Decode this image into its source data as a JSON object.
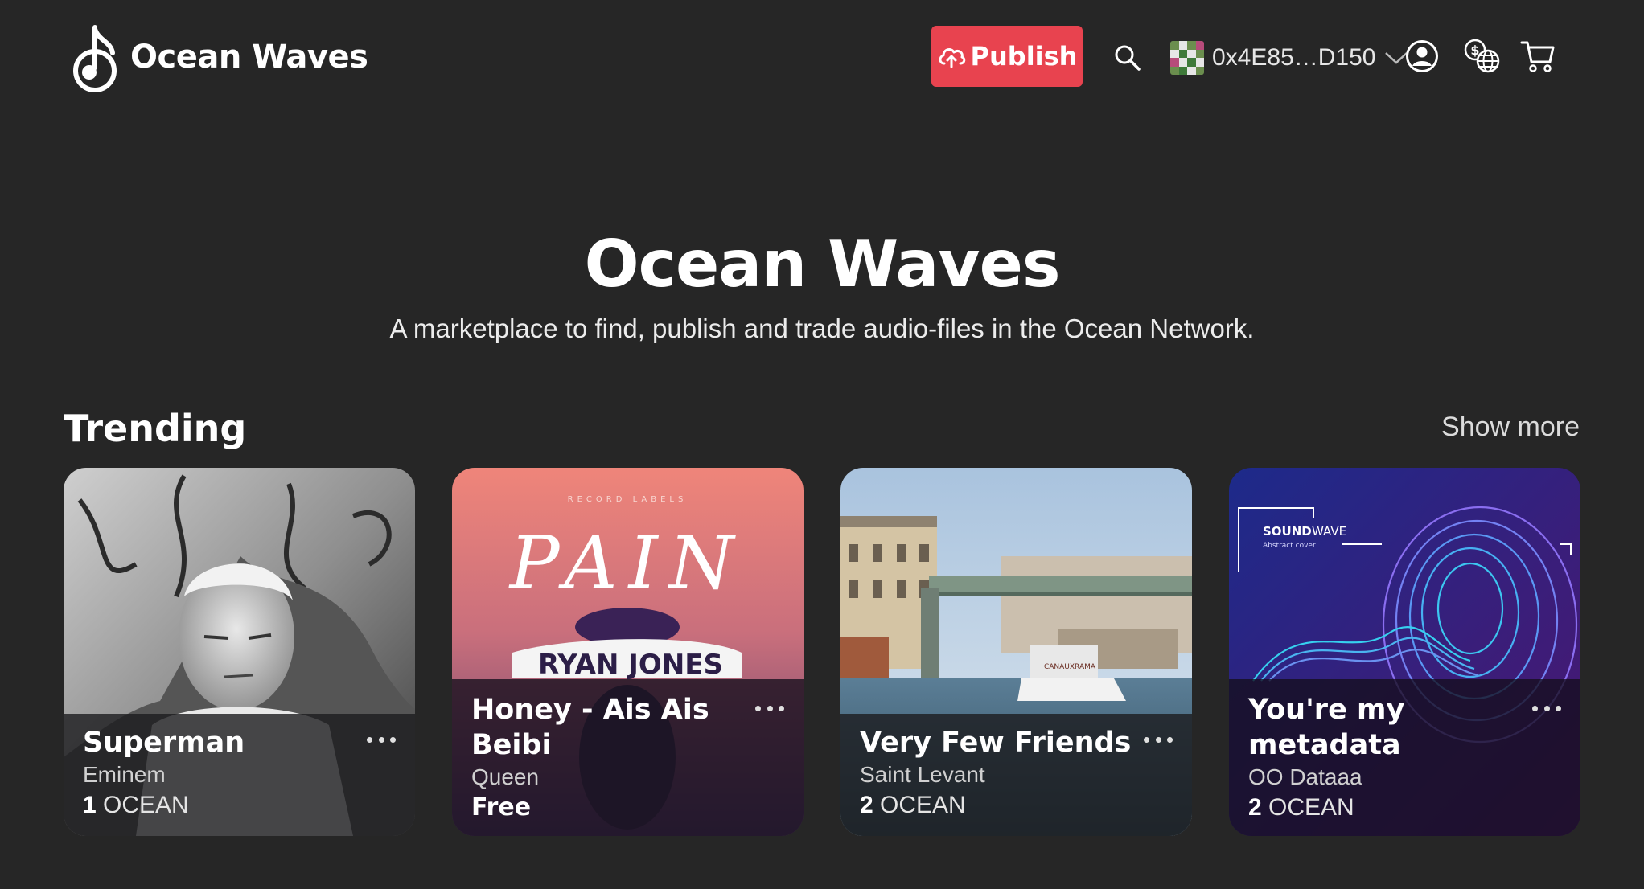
{
  "header": {
    "brand_name": "Ocean Waves",
    "publish_label": "Publish",
    "wallet_address": "0x4E85…D150"
  },
  "hero": {
    "title": "Ocean Waves",
    "subtitle": "A marketplace to find, publish and trade audio-files in the Ocean Network."
  },
  "trending": {
    "title": "Trending",
    "show_more_label": "Show more",
    "cards": [
      {
        "title": "Superman",
        "artist": "Eminem",
        "price_amount": "1",
        "price_unit": "OCEAN"
      },
      {
        "title": "Honey - Ais Ais Beibi",
        "artist": "Queen",
        "price_free": "Free",
        "cover_text_top": "RECORD LABELS",
        "cover_text_main": "PAIN",
        "cover_text_name": "RYAN JONES"
      },
      {
        "title": "Very Few Friends",
        "artist": "Saint Levant",
        "price_amount": "2",
        "price_unit": "OCEAN",
        "cover_text_boat": "CANAUXRAMA"
      },
      {
        "title": "You're my metadata",
        "artist": "OO Dataaa",
        "price_amount": "2",
        "price_unit": "OCEAN",
        "cover_text_top": "SOUND",
        "cover_text_top2": "WAVE",
        "cover_text_sub": "Abstract cover"
      }
    ]
  },
  "colors": {
    "background": "#262626",
    "publish": "#e8434f"
  }
}
